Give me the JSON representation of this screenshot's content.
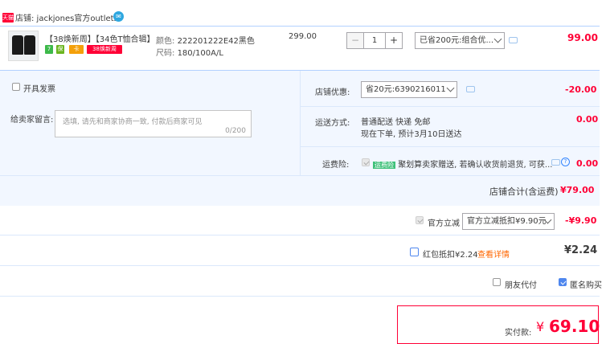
{
  "shop": {
    "badge": "天猫",
    "label": "店铺: jackjones官方outlets"
  },
  "item": {
    "title": "【38焕新周】【34色T恤合辑】...",
    "badges": [
      {
        "text": "7",
        "color": "#3db94a"
      },
      {
        "text": "保",
        "color": "#6bb51f"
      },
      {
        "text": "卡",
        "color": "#f4a00a"
      },
      {
        "text": "38焕新周",
        "color": "#ff0036"
      }
    ],
    "color_label": "颜色:",
    "color_value": "222201222E42黑色",
    "size_label": "尺码:",
    "size_value": "180/100A/L",
    "unit_price": "299.00",
    "quantity": "1",
    "minus": "−",
    "plus": "+",
    "discount_option": "已省200元:组合优...",
    "line_total": "99.00"
  },
  "invoice": {
    "label": "开具发票"
  },
  "message": {
    "label": "给卖家留言:",
    "placeholder": "选填, 请先和商家协商一致, 付款后商家可见",
    "counter": "0/200"
  },
  "shop_discount": {
    "label": "店铺优惠:",
    "option": "省20元:6390216011",
    "amount": "-20.00"
  },
  "shipping": {
    "label": "运送方式:",
    "method": "普通配送 快递 免邮",
    "eta": "现在下单, 预计3月10日送达",
    "amount": "0.00"
  },
  "insurance": {
    "label": "运费险:",
    "tag": "运费险",
    "desc": "聚划算卖家赠送, 若确认收货前退货, 可获...",
    "help": "?",
    "amount": "0.00"
  },
  "shop_total": {
    "label": "店铺合计(含运费)",
    "amount": "¥79.00"
  },
  "official_discount": {
    "label": "官方立减",
    "option": "官方立减抵扣¥9.90元",
    "amount": "-¥9.90"
  },
  "red_packet": {
    "label": "红包抵扣¥2.24",
    "link": "查看详情",
    "amount": "¥2.24"
  },
  "options": {
    "friend_pay": "朋友代付",
    "anonymous": "匿名购买"
  },
  "payment": {
    "label": "实付款:",
    "currency": "¥",
    "amount": "69.10"
  },
  "colors": {
    "accent": "#ff0036",
    "link": "#3385ff",
    "panel": "#f2f7ff",
    "border": "#b2d1ff"
  }
}
